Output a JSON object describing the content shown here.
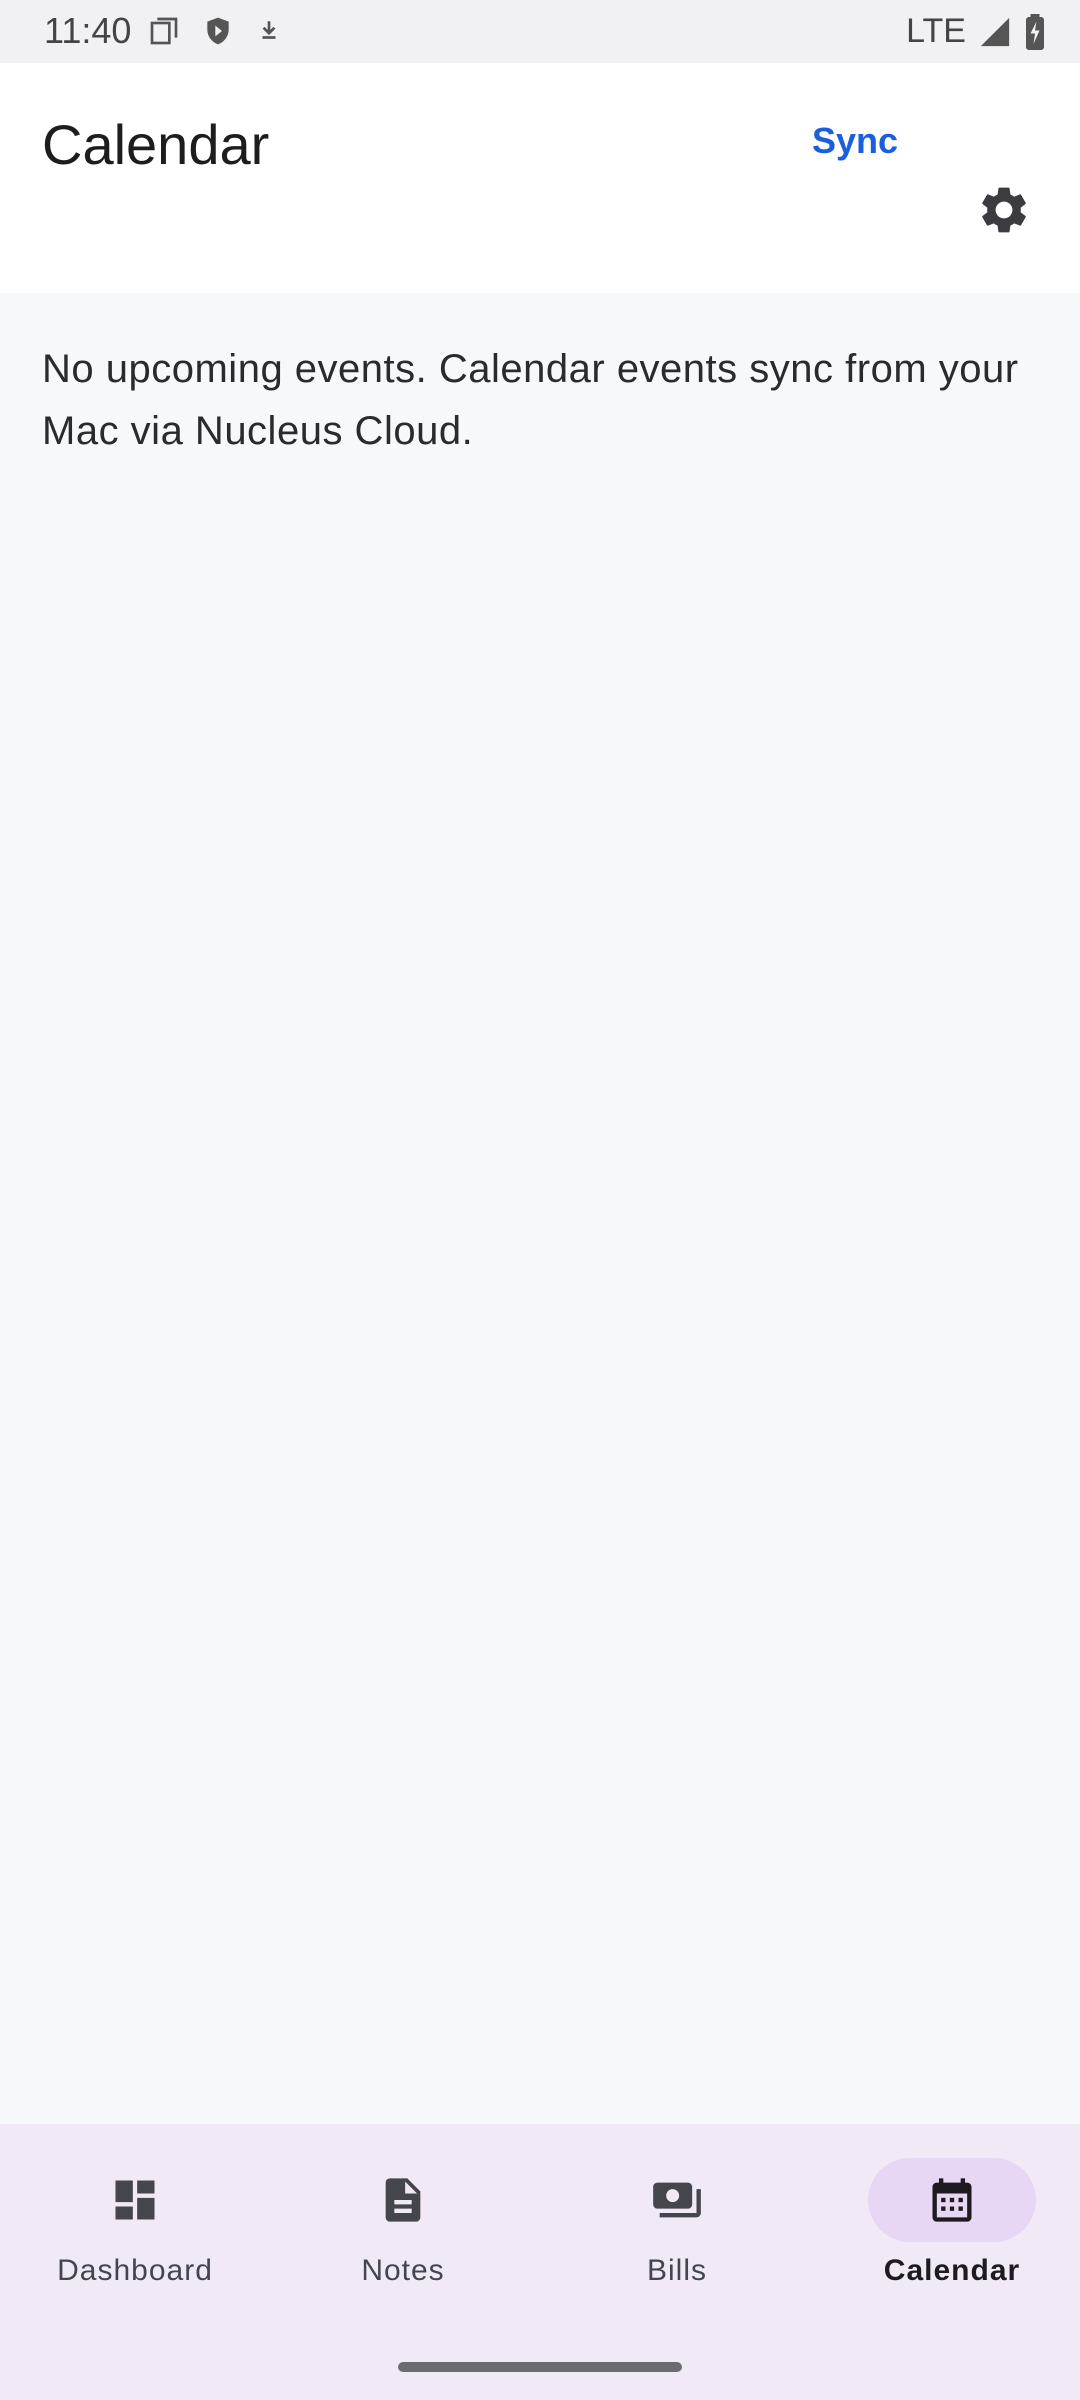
{
  "status_bar": {
    "time": "11:40",
    "network": "LTE",
    "left_icons": [
      "screenshot-icon",
      "shield-play-icon",
      "download-icon"
    ],
    "right_icons": [
      "signal-icon",
      "battery-charging-icon"
    ]
  },
  "header": {
    "title": "Calendar",
    "sync_label": "Sync",
    "settings_icon": "gear-icon"
  },
  "content": {
    "empty_message": "No upcoming events. Calendar events sync from your Mac via Nucleus Cloud."
  },
  "bottom_nav": {
    "items": [
      {
        "label": "Dashboard",
        "icon": "dashboard-icon",
        "active": false
      },
      {
        "label": "Notes",
        "icon": "notes-icon",
        "active": false
      },
      {
        "label": "Bills",
        "icon": "bills-icon",
        "active": false
      },
      {
        "label": "Calendar",
        "icon": "calendar-icon",
        "active": true
      }
    ]
  },
  "colors": {
    "accent": "#1a5fe0",
    "nav_background": "#f1eaf6",
    "active_indicator": "#e7d6f4",
    "page_background": "#f7f8fa"
  }
}
